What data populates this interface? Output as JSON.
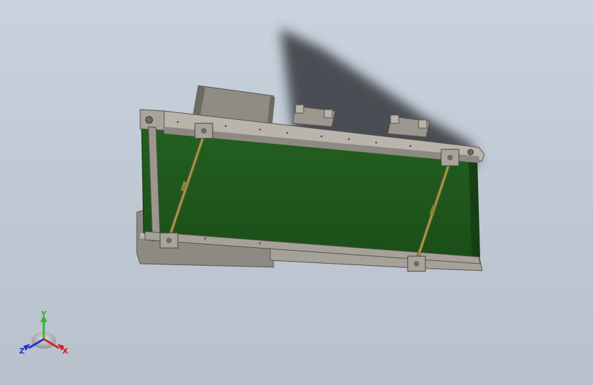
{
  "viewport": {
    "background_top": "#c9d2dd",
    "background_bottom": "#b8c1cc"
  },
  "model": {
    "belt_color": "#1f5a1c",
    "frame_color": "#b9b5ad",
    "frame_dark": "#8d8a84",
    "rod_color": "#8a7f3c",
    "shadow_color": "#3c3f45"
  },
  "triad": {
    "y_label": "Y",
    "x_label": "X",
    "z_label": "Z",
    "y_color": "#2fb82f",
    "x_color": "#d42020",
    "z_color": "#2030d0"
  }
}
